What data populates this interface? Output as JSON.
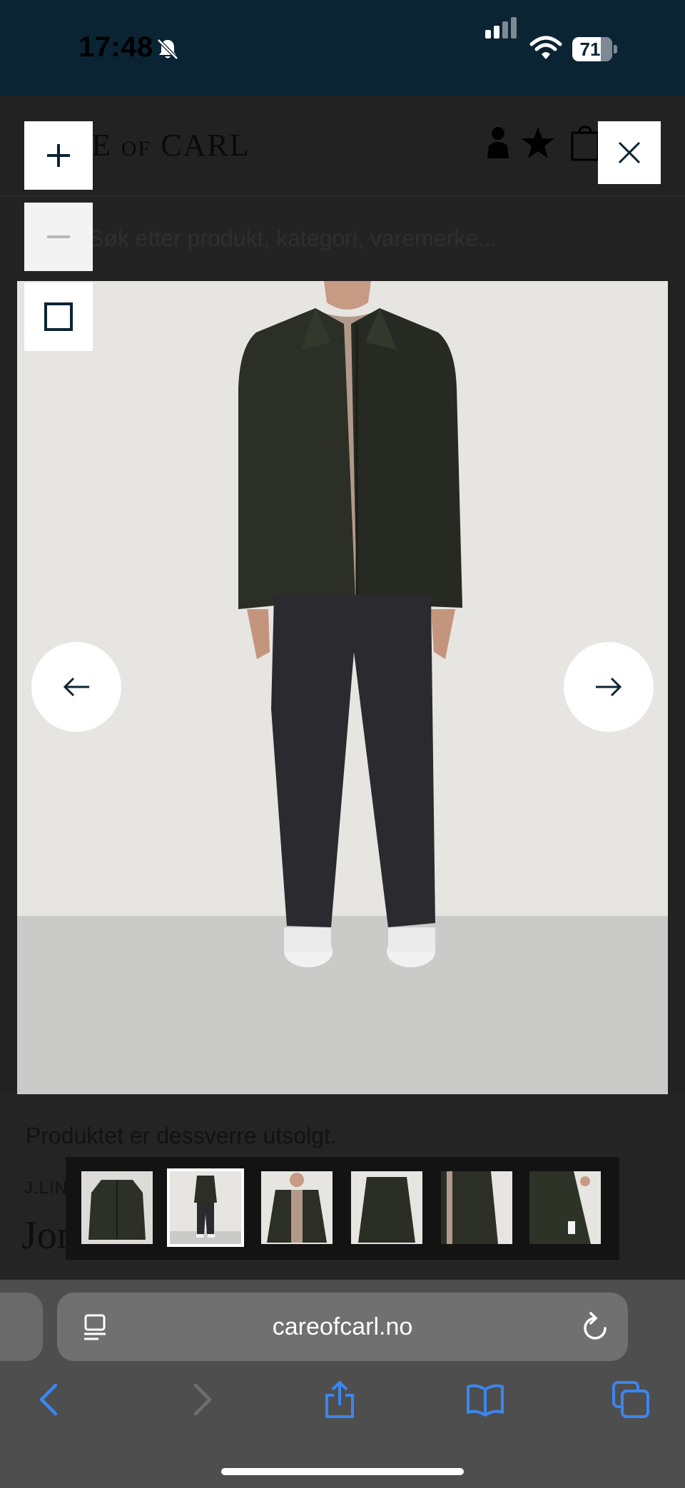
{
  "status_bar": {
    "time": "17:48",
    "battery_level": "71",
    "battery_fraction": 0.71
  },
  "site": {
    "logo_prefix": "E",
    "logo_of": "OF",
    "logo_main": "CARL",
    "search_placeholder": "Søk etter produkt, kategori, varemerke...",
    "soldout_text": "Produktet er dessverre utsolgt.",
    "brand": "J.LIND",
    "product_name": "Jona"
  },
  "overlay": {
    "zoom_in_icon": "plus-icon",
    "zoom_out_icon": "minus-icon",
    "fullscreen_icon": "square-icon",
    "close_icon": "close-icon",
    "prev_icon": "arrow-left-icon",
    "next_icon": "arrow-right-icon",
    "thumbnails": [
      {
        "subject": "jacket flat lay",
        "active": false
      },
      {
        "subject": "model full body front",
        "active": true
      },
      {
        "subject": "model upper body front",
        "active": false
      },
      {
        "subject": "jacket back",
        "active": false
      },
      {
        "subject": "jacket detail side",
        "active": false
      },
      {
        "subject": "jacket inside lining",
        "active": false
      }
    ]
  },
  "browser": {
    "url": "careofcarl.no",
    "back_icon": "chevron-left-icon",
    "forward_icon": "chevron-right-icon",
    "share_icon": "share-icon",
    "bookmarks_icon": "book-icon",
    "tabs_icon": "tabs-icon"
  },
  "colors": {
    "status_bar_bg": "#0b2434",
    "overlay_bg": "#222222",
    "browser_bar_bg": "#4e4e4e",
    "accent_blue": "#3b86f0"
  }
}
